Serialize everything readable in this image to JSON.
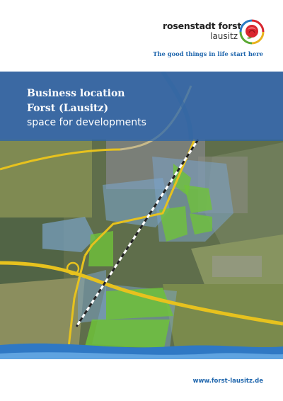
{
  "brand": {
    "name": "rosenstadt forst",
    "subname": "lausitz",
    "tagline": "The good things in life start here"
  },
  "title": {
    "line1": "Business location",
    "line2": "Forst (Lausitz)",
    "line3": "space for developments"
  },
  "footer": {
    "url": "www.forst-lausitz.de"
  },
  "colors": {
    "brand_blue": "#1f66ad",
    "title_band": "#2864aa",
    "plot_green": "#6fc23a",
    "road_yellow": "#e7c21e",
    "rose_red": "#d8262f",
    "rose_green": "#5aa832"
  }
}
